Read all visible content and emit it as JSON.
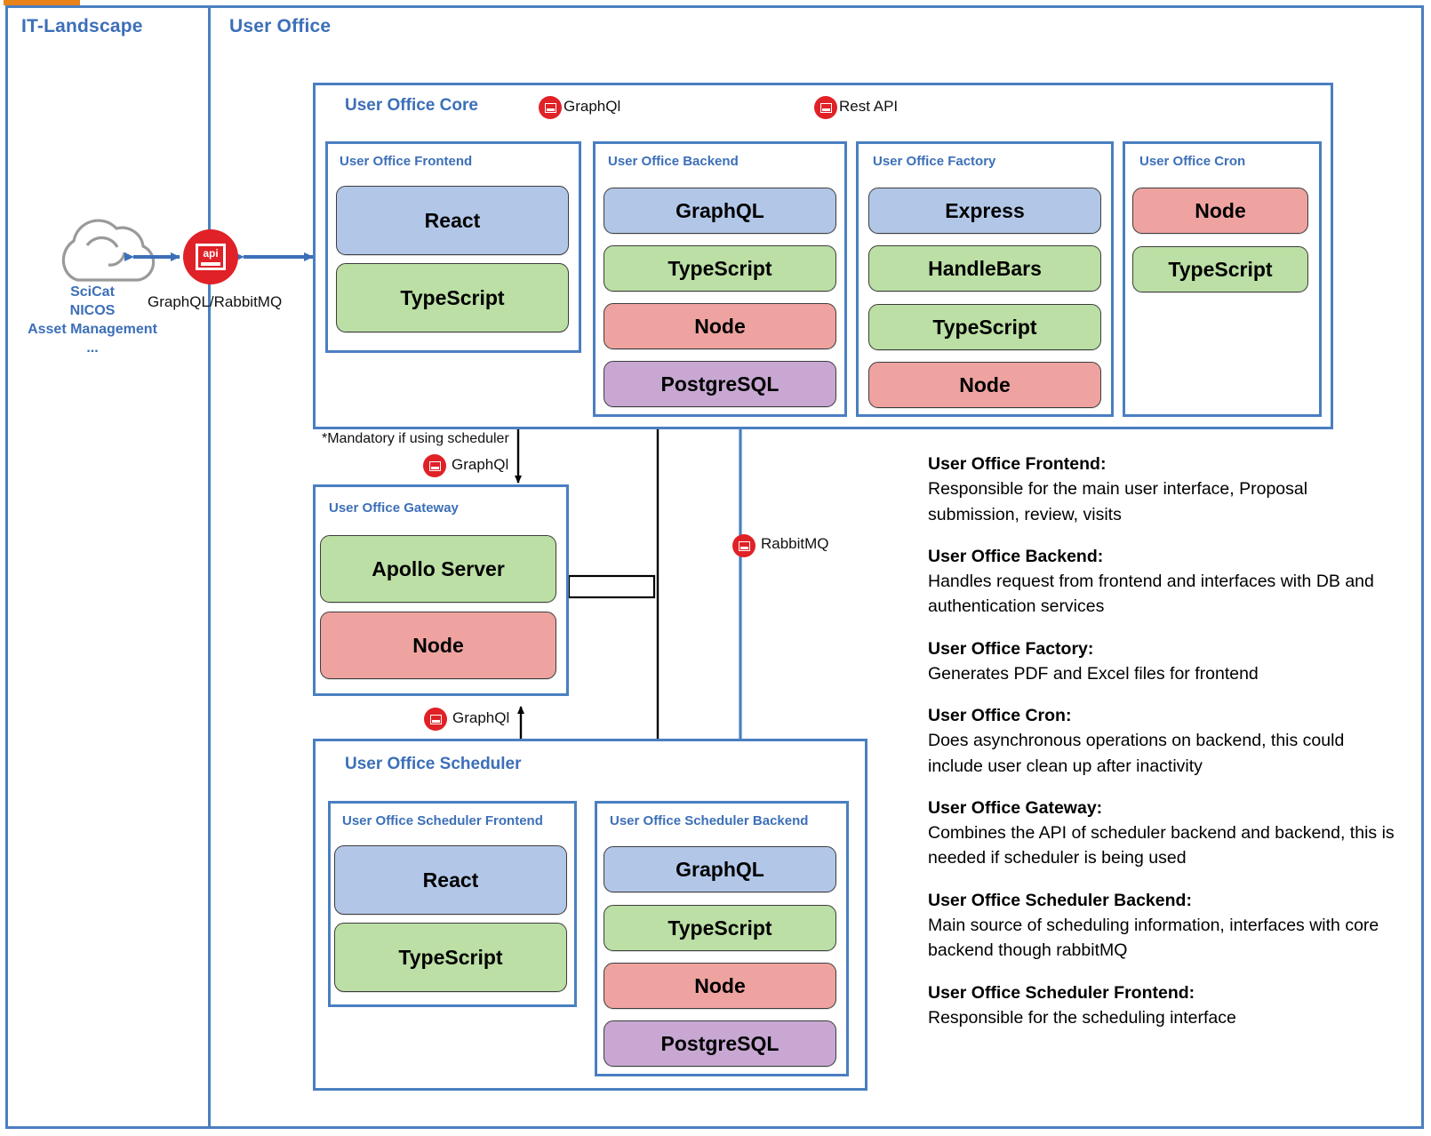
{
  "zones": {
    "left_title": "IT-Landscape",
    "right_title": "User Office"
  },
  "it_landscape": {
    "cloud_icon": "cloud-icon",
    "cloud_label_lines": [
      "SciCat",
      "NICOS",
      "Asset Management",
      "..."
    ],
    "api_icon_text": "api",
    "api_connector_label": "GraphQL/RabbitMQ"
  },
  "core": {
    "title": "User Office Core",
    "connectors": [
      {
        "icon": "api-icon",
        "label": "GraphQl"
      },
      {
        "icon": "api-icon",
        "label": "Rest API"
      }
    ],
    "modules": [
      {
        "title": "User Office Frontend",
        "tech": [
          {
            "name": "React",
            "color": "#b2c7e8"
          },
          {
            "name": "TypeScript",
            "color": "#bbdfa4"
          }
        ]
      },
      {
        "title": "User Office Backend",
        "tech": [
          {
            "name": "GraphQL",
            "color": "#b2c7e8"
          },
          {
            "name": "TypeScript",
            "color": "#bbdfa4"
          },
          {
            "name": "Node",
            "color": "#eea3a0"
          },
          {
            "name": "PostgreSQL",
            "color": "#c8a8d3"
          }
        ]
      },
      {
        "title": "User Office Factory",
        "tech": [
          {
            "name": "Express",
            "color": "#b2c7e8"
          },
          {
            "name": "HandleBars",
            "color": "#bbdfa4"
          },
          {
            "name": "TypeScript",
            "color": "#bbdfa4"
          },
          {
            "name": "Node",
            "color": "#eea3a0"
          }
        ]
      },
      {
        "title": "User Office Cron",
        "tech": [
          {
            "name": "Node",
            "color": "#eea3a0"
          },
          {
            "name": "TypeScript",
            "color": "#bbdfa4"
          }
        ]
      }
    ]
  },
  "gateway": {
    "title": "User Office Gateway",
    "mandatory_note": "*Mandatory if using scheduler",
    "top_connector_label": "GraphQl",
    "bottom_connector_label": "GraphQl",
    "tech": [
      {
        "name": "Apollo Server",
        "color": "#bbdfa4"
      },
      {
        "name": "Node",
        "color": "#eea3a0"
      }
    ]
  },
  "rabbitmq_connector": {
    "icon": "api-icon",
    "label": "RabbitMQ"
  },
  "scheduler": {
    "title": "User Office Scheduler",
    "modules": [
      {
        "title": "User Office Scheduler Frontend",
        "tech": [
          {
            "name": "React",
            "color": "#b2c7e8"
          },
          {
            "name": "TypeScript",
            "color": "#bbdfa4"
          }
        ]
      },
      {
        "title": "User Office Scheduler Backend",
        "tech": [
          {
            "name": "GraphQL",
            "color": "#b2c7e8"
          },
          {
            "name": "TypeScript",
            "color": "#bbdfa4"
          },
          {
            "name": "Node",
            "color": "#eea3a0"
          },
          {
            "name": "PostgreSQL",
            "color": "#c8a8d3"
          }
        ]
      }
    ]
  },
  "descriptions": [
    {
      "heading": "User Office Frontend:",
      "body": "Responsible for the main user interface, Proposal submission, review, visits"
    },
    {
      "heading": "User Office Backend:",
      "body": "Handles request from frontend and interfaces with DB and authentication services"
    },
    {
      "heading": "User Office Factory:",
      "body": "Generates PDF and Excel files for frontend"
    },
    {
      "heading": "User Office Cron:",
      "body": "Does asynchronous operations on backend, this could include user clean up after inactivity"
    },
    {
      "heading": "User Office Gateway:",
      "body": "Combines the API of scheduler backend and backend, this is needed if scheduler is being used"
    },
    {
      "heading": "User Office Scheduler Backend:",
      "body": "Main source of scheduling information, interfaces with core backend though rabbitMQ"
    },
    {
      "heading": "User Office Scheduler Frontend:",
      "body": "Responsible for the scheduling interface"
    }
  ],
  "colors": {
    "frame_blue": "#4a7fc1",
    "title_blue": "#3c6fb8",
    "api_red": "#e02127",
    "tech_blue": "#b2c7e8",
    "tech_green": "#bbdfa4",
    "tech_red": "#eea3a0",
    "tech_purple": "#c8a8d3"
  }
}
